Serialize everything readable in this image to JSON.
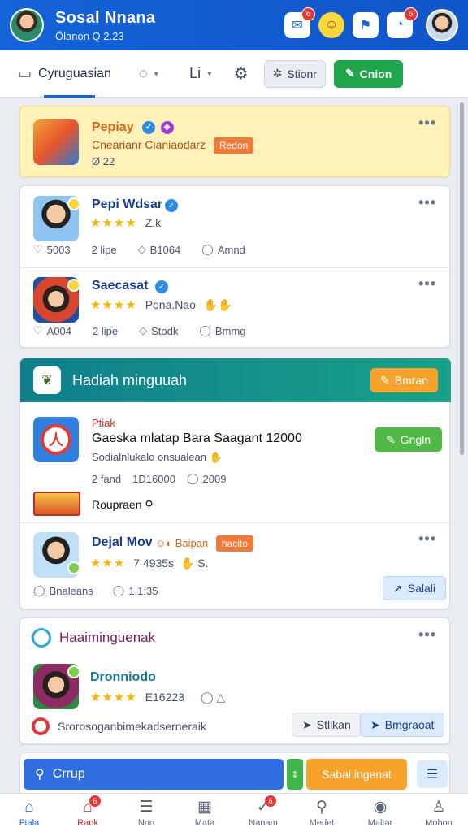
{
  "header": {
    "title": "Sosal Nnana",
    "subtitle": "Ölanon Q 2.23",
    "badges": {
      "chat": "6",
      "notify": "6"
    },
    "icons": [
      "chat-icon",
      "emoji-icon",
      "flag-icon",
      "notification-icon"
    ]
  },
  "toolbar": {
    "tab_label": "Cyruguasian",
    "grey_button": "Stionr",
    "green_button": "Cnion"
  },
  "feed": [
    {
      "name": "Pepiay",
      "subtitle": "Cnearianr Cianiaodarz",
      "tag": "Redon",
      "meta": "Ø 22"
    },
    {
      "name": "Pepi Wdsar",
      "rating": "★★★★",
      "extra": "Z.k",
      "stats": [
        "5003",
        "2 lipe",
        "B1064",
        "Amnd"
      ]
    },
    {
      "name": "Saecasat",
      "rating": "★★★★",
      "extra": "Pona.Nao",
      "stats": [
        "A004",
        "2 lipe",
        "Stodk",
        "Bmmg"
      ]
    }
  ],
  "promo": {
    "banner_title": "Hadiah minguuah",
    "banner_button": "Bmran",
    "post_label": "Ptiak",
    "post_title": "Gaeska mlatap Bara Saagant 12000",
    "post_subtitle": "Sodialnlukalo onsualean",
    "post_button": "Gngln",
    "post_stats": [
      "2 fand",
      "1Ð16000",
      "2009"
    ],
    "reward_label": "Roupraen",
    "user_name": "Dejal Mov",
    "user_extra": "Baipan",
    "user_tag": "hacito",
    "user_rating": "★★★",
    "user_stat": "7 4935s",
    "user_stat2": "S.",
    "footer_stats": [
      "Bnaleans",
      "1.1:35"
    ],
    "footer_button": "Salali"
  },
  "group": {
    "title": "Haaiminguenak",
    "name": "Dronniodo",
    "rating": "★★★★",
    "stat": "E16223",
    "footer_text": "Srorosoganbimekadserneraik",
    "btn_plain": "Stllkan",
    "btn_light": "Bmgraoat"
  },
  "search": {
    "placeholder": "Crrup",
    "button": "Sabal ingenat"
  },
  "bottom_nav": [
    {
      "label": "Ftala",
      "icon": "home-icon"
    },
    {
      "label": "Rank",
      "icon": "house-icon",
      "badge": "6"
    },
    {
      "label": "Noo",
      "icon": "list-icon"
    },
    {
      "label": "Mata",
      "icon": "grid-icon"
    },
    {
      "label": "Nanam",
      "icon": "check-icon",
      "badge": "6"
    },
    {
      "label": "Medet",
      "icon": "search-icon"
    },
    {
      "label": "Maltar",
      "icon": "circle-icon"
    },
    {
      "label": "Mohon",
      "icon": "user-icon"
    }
  ]
}
